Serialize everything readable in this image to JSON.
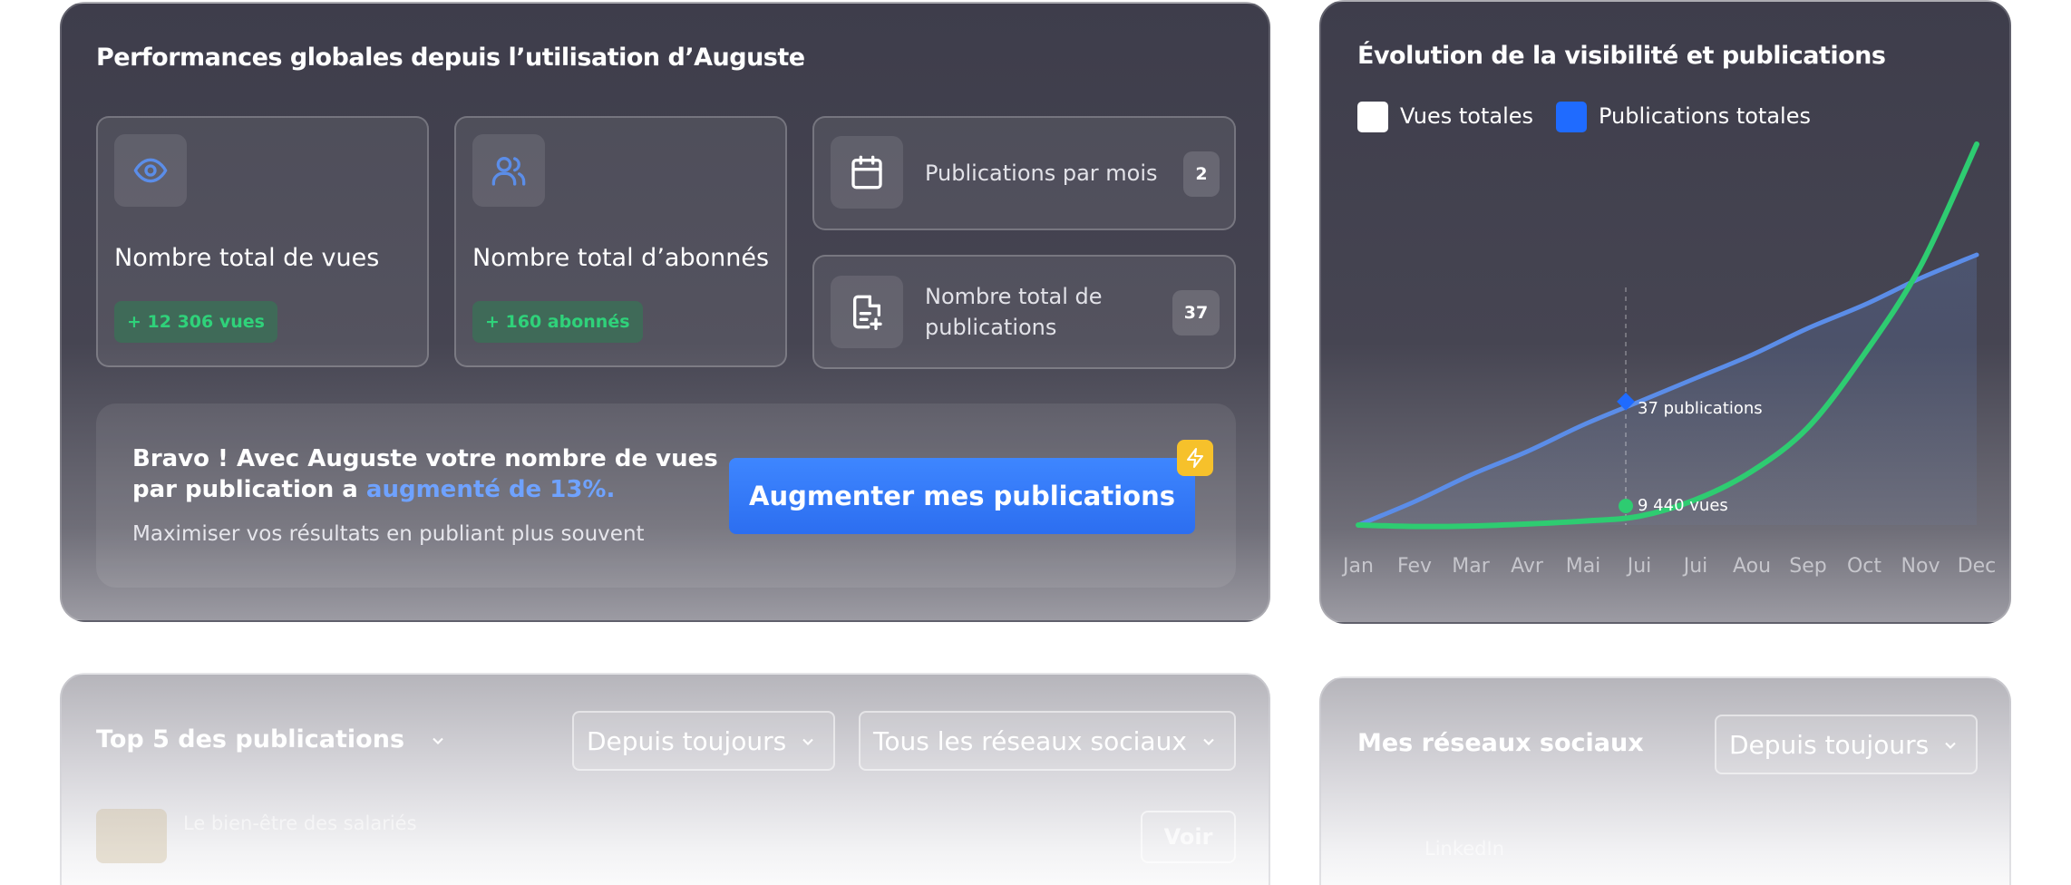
{
  "performance": {
    "title": "Performances globales depuis l’utilisation d’Auguste",
    "views": {
      "label": "Nombre total de vues",
      "delta": "+ 12 306 vues"
    },
    "followers": {
      "label": "Nombre total d’abonnés",
      "delta": "+ 160 abonnés"
    },
    "per_month": {
      "label": "Publications par mois",
      "value": "2"
    },
    "total_pubs": {
      "label": "Nombre total de publications",
      "value": "37"
    },
    "promo": {
      "headline_prefix": "Bravo ! Avec Auguste votre nombre de vues par publication a",
      "headline_highlight": "augmenté de 13%.",
      "subtext": "Maximiser vos résultats en publiant plus souvent",
      "cta_label": "Augmenter mes publications"
    }
  },
  "chart_card": {
    "title": "Évolution de la visibilité et publications",
    "legend": [
      {
        "label": "Vues totales",
        "color": "#ffffff"
      },
      {
        "label": "Publications totales",
        "color": "#1f6bff"
      }
    ],
    "annotations": {
      "publications": "37 publications",
      "views": "9 440 vues"
    }
  },
  "chart_data": {
    "type": "line",
    "title": "Évolution de la visibilité et publications",
    "categories": [
      "Jan",
      "Fev",
      "Mar",
      "Avr",
      "Mai",
      "Jui",
      "Jui",
      "Aou",
      "Sep",
      "Oct",
      "Nov",
      "Dec"
    ],
    "series": [
      {
        "name": "Vues totales",
        "color": "#2ecc71",
        "values": [
          0,
          -150,
          -100,
          100,
          400,
          900,
          2600,
          5500,
          10000,
          17500,
          26500,
          39000
        ]
      },
      {
        "name": "Publications totales",
        "color": "#5b8de8",
        "values": [
          0,
          7,
          15,
          22,
          30,
          37,
          44,
          51,
          59,
          66,
          74,
          81
        ]
      }
    ],
    "highlight": {
      "category": "Jui",
      "publications": 37,
      "views": 9440
    },
    "grid": false,
    "legend_position": "top-left"
  },
  "top_posts": {
    "title": "Top 5 des publications",
    "period_filter": "Depuis toujours",
    "network_filter": "Tous les réseaux sociaux",
    "first_row": {
      "title": "Le bien-être des salariés",
      "action": "Voir"
    }
  },
  "social": {
    "title": "Mes réseaux sociaux",
    "period_filter": "Depuis toujours",
    "first_network": "LinkedIn"
  },
  "icons": {
    "views": "eye-icon",
    "followers": "users-icon",
    "per_month": "calendar-icon",
    "total_pubs": "document-add-icon",
    "promo": "lightning-icon",
    "dropdown": "chevron-down-icon"
  }
}
